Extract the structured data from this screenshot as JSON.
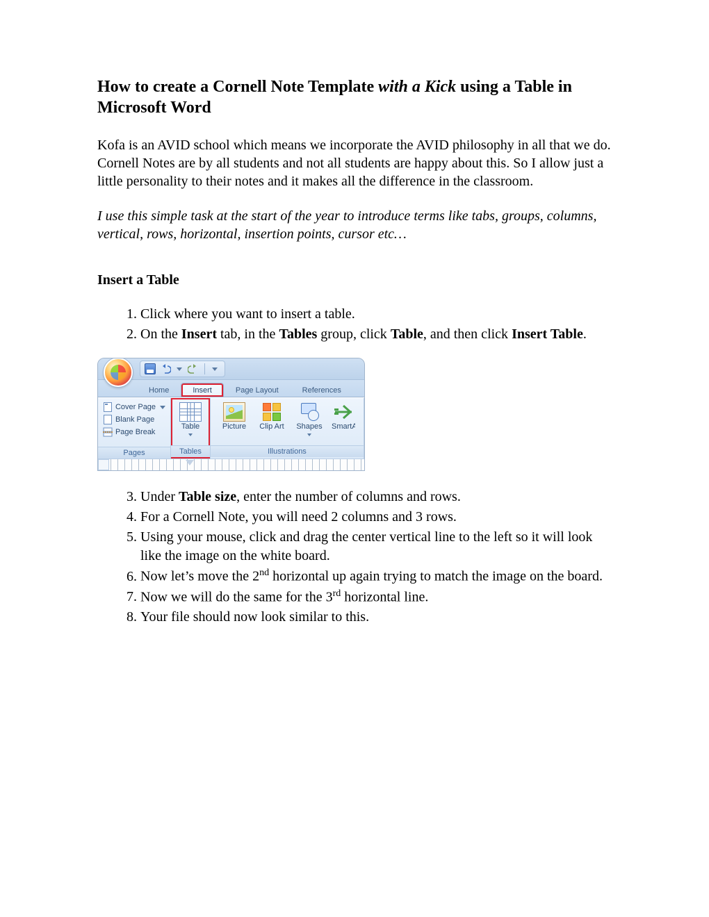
{
  "title_parts": {
    "pre": "How to create a Cornell Note Template ",
    "italic": "with a Kick",
    "post": " using a Table in Microsoft Word"
  },
  "para1": "Kofa is an AVID school which means we incorporate the AVID philosophy in all that we do. Cornell Notes are by all students and not all students are happy about this. So I allow just a little personality to their notes and it makes all the difference in the classroom.",
  "para2": "I use this simple task at the start of the year to introduce terms like tabs, groups, columns, vertical, rows, horizontal, insertion points, cursor etc…",
  "section1": "Insert a Table",
  "steps_a": [
    "Click where you want to insert a table."
  ],
  "step2": {
    "pre": "On the ",
    "b1": "Insert",
    "mid1": " tab, in the ",
    "b2": "Tables",
    "mid2": " group, click ",
    "b3": "Table",
    "mid3": ", and then click ",
    "b4": "Insert Table",
    "post": "."
  },
  "ribbon": {
    "tabs": {
      "home": "Home",
      "insert": "Insert",
      "page_layout": "Page Layout",
      "references": "References"
    },
    "groups": {
      "pages": "Pages",
      "tables": "Tables",
      "illustrations": "Illustrations"
    },
    "pages_items": {
      "cover": "Cover Page",
      "blank": "Blank Page",
      "break": "Page Break"
    },
    "buttons": {
      "table": "Table",
      "picture": "Picture",
      "clip": "Clip Art",
      "shapes": "Shapes",
      "smart": "SmartArt"
    }
  },
  "step3": {
    "pre": "Under ",
    "b": "Table size",
    "post": ", enter the number of columns and rows."
  },
  "steps_b": [
    "For a Cornell Note, you will need 2 columns and 3 rows.",
    "Using your mouse, click and drag the center vertical line to the left so it will look like the image on the white board."
  ],
  "step6": {
    "pre": "Now let’s move the 2",
    "sup": "nd",
    "post": " horizontal up again trying to match the image on the board."
  },
  "step7": {
    "pre": "Now we will do the same for the 3",
    "sup": "rd",
    "post": " horizontal line."
  },
  "step8": "Your file should now look similar to this."
}
